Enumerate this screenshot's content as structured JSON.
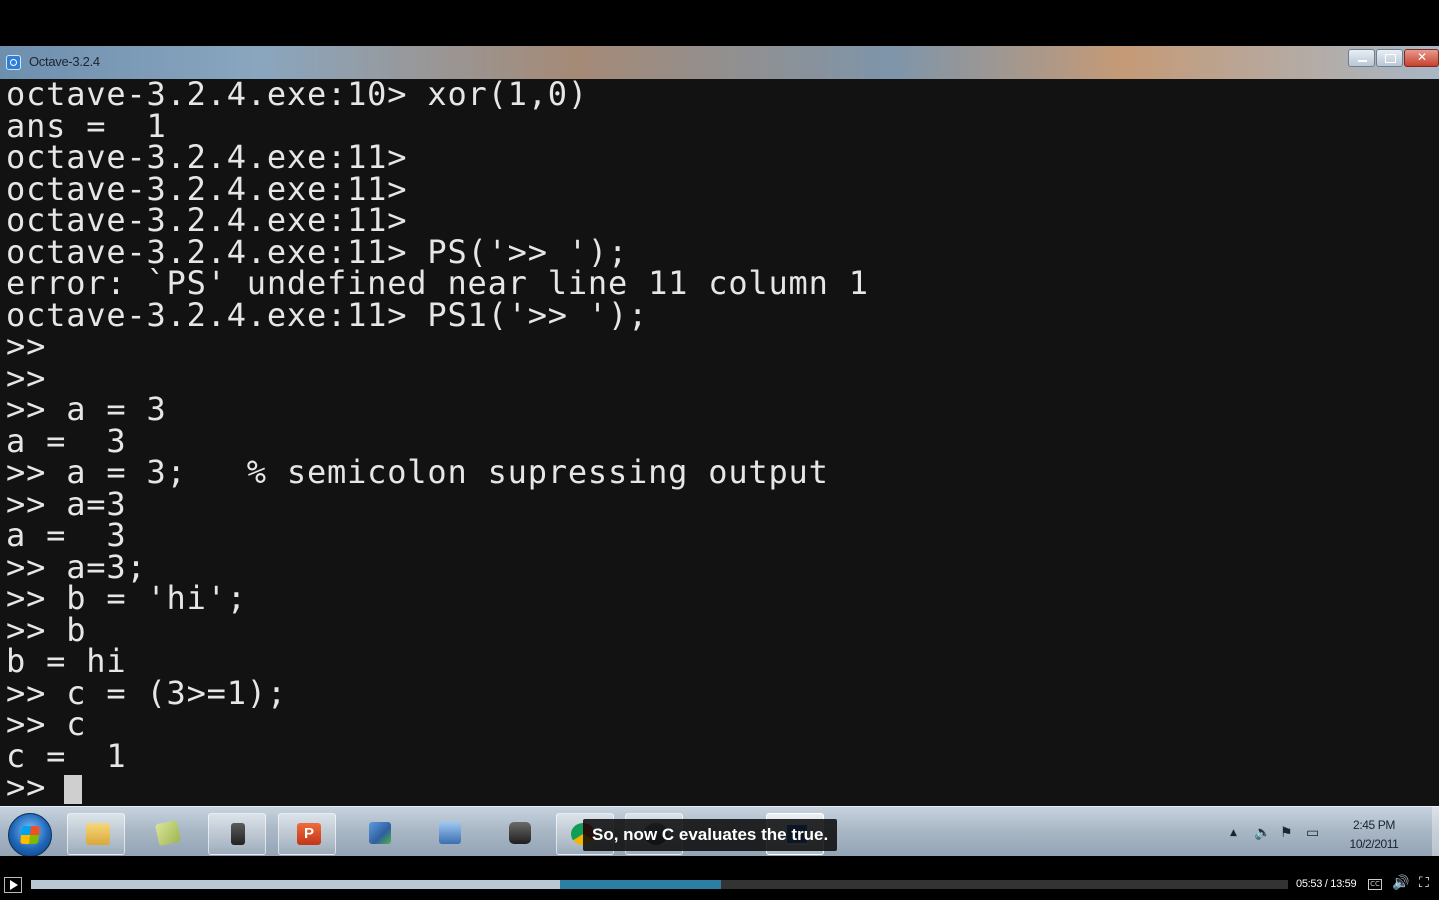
{
  "window": {
    "title": "Octave-3.2.4"
  },
  "console": {
    "lines": [
      "octave-3.2.4.exe:10> xor(1,0)",
      "ans =  1",
      "octave-3.2.4.exe:11>",
      "octave-3.2.4.exe:11>",
      "octave-3.2.4.exe:11>",
      "octave-3.2.4.exe:11> PS('>> ');",
      "error: `PS' undefined near line 11 column 1",
      "octave-3.2.4.exe:11> PS1('>> ');",
      ">>",
      ">>",
      ">> a = 3",
      "a =  3",
      ">> a = 3;   % semicolon supressing output",
      ">> a=3",
      "a =  3",
      ">> a=3;",
      ">> b = 'hi';",
      ">> b",
      "b = hi",
      ">> c = (3>=1);",
      ">> c",
      "c =  1",
      ">>"
    ]
  },
  "taskbar": {
    "caption": "So, now C evaluates the true.",
    "clock_time": "2:45 PM",
    "clock_date": "10/2/2011",
    "items": [
      "windows-explorer",
      "notes",
      "tools",
      "powerpoint",
      "network-manager",
      "remote-desktop",
      "camera",
      "chrome",
      "app",
      "octave"
    ]
  },
  "player": {
    "time_readout": "05:53 / 13:59",
    "played_fraction": 0.421,
    "buffered_fraction": 0.549,
    "cc_label": "CC"
  },
  "colors": {
    "console_bg": "#121212",
    "console_text": "#e6e6e6",
    "progress_played": "#b9c7d2",
    "progress_buffered": "#2c7fa3"
  }
}
